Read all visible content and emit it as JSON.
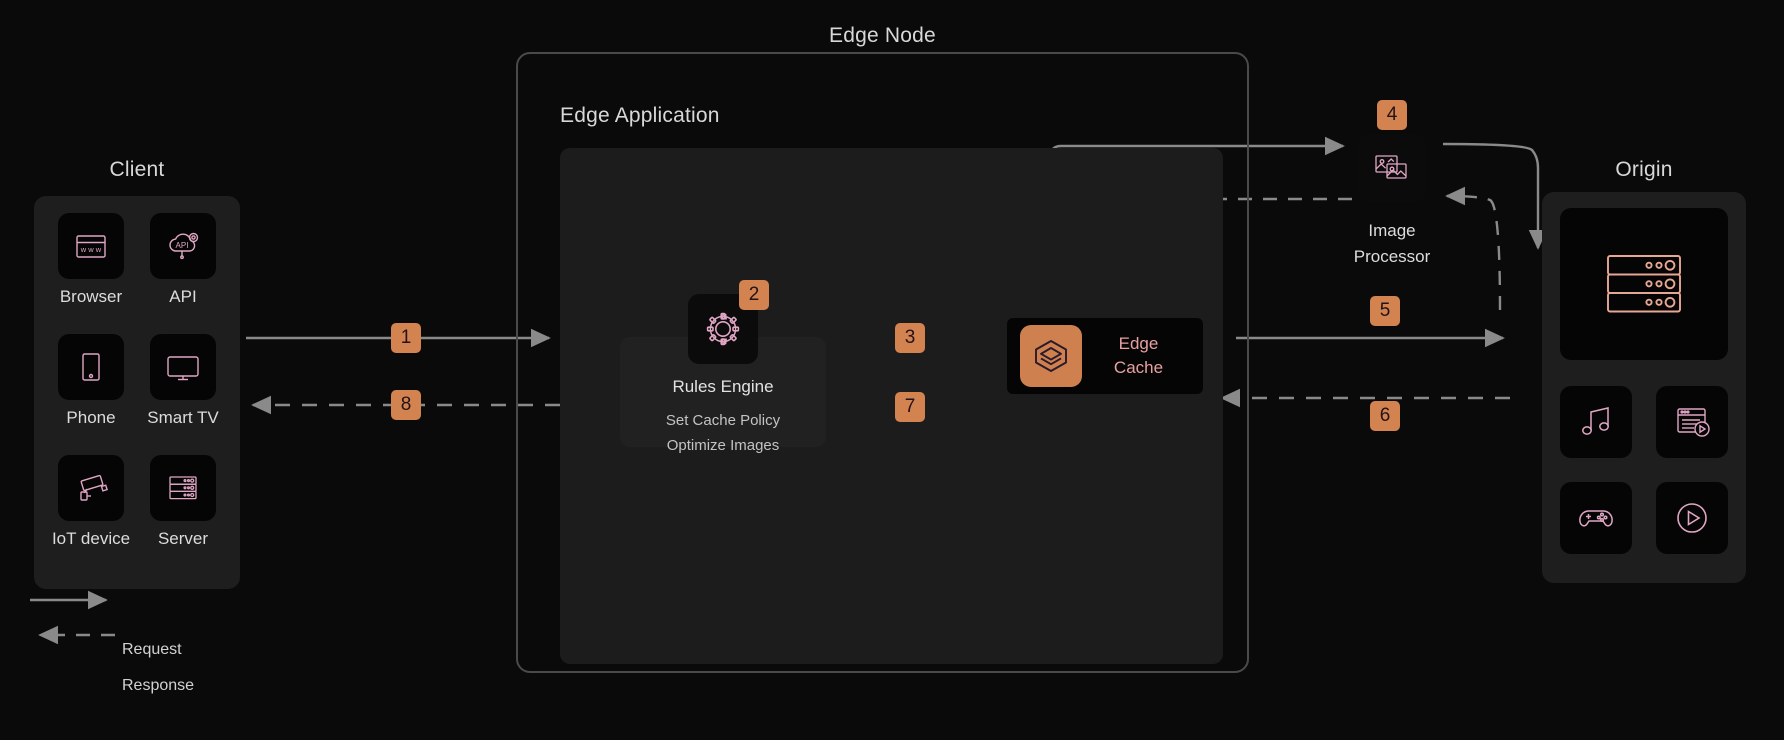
{
  "groups": {
    "client_title": "Client",
    "edge_node_title": "Edge Node",
    "edge_app_title": "Edge Application",
    "origin_title": "Origin"
  },
  "client": {
    "devices": [
      {
        "label": "Browser",
        "icon": "browser-www-icon"
      },
      {
        "label": "API",
        "icon": "api-cloud-icon"
      },
      {
        "label": "Phone",
        "icon": "phone-icon"
      },
      {
        "label": "Smart TV",
        "icon": "smart-tv-icon"
      },
      {
        "label": "IoT device",
        "icon": "security-camera-icon"
      },
      {
        "label": "Server",
        "icon": "server-rack-icon"
      }
    ]
  },
  "rules_engine": {
    "title": "Rules Engine",
    "icon": "gear-icon",
    "actions": [
      "Set Cache Policy",
      "Optimize Images"
    ]
  },
  "edge_cache": {
    "title_line1": "Edge",
    "title_line2": "Cache",
    "icon": "layers-stack-icon"
  },
  "image_processor": {
    "label_line1": "Image",
    "label_line2": "Processor",
    "icon": "image-processing-icon"
  },
  "origin": {
    "main": {
      "icon": "server-rack-icon"
    },
    "assets": [
      {
        "icon": "music-note-icon"
      },
      {
        "icon": "video-page-icon"
      },
      {
        "icon": "game-controller-icon"
      },
      {
        "icon": "play-circle-icon"
      }
    ]
  },
  "steps": [
    {
      "id": "1",
      "number": "1"
    },
    {
      "id": "2",
      "number": "2"
    },
    {
      "id": "3",
      "number": "3"
    },
    {
      "id": "4",
      "number": "4"
    },
    {
      "id": "5",
      "number": "5"
    },
    {
      "id": "6",
      "number": "6"
    },
    {
      "id": "7",
      "number": "7"
    },
    {
      "id": "8",
      "number": "8"
    }
  ],
  "legend": {
    "request": "Request",
    "response": "Response"
  },
  "colors": {
    "background": "#0a0a0a",
    "panel": "#1e1e1e",
    "tile": "#050505",
    "accent_orange": "#d3834f",
    "wire": "#8a8a8a",
    "icon_pink": "#e0a6c4",
    "origin_icon": "#e7a893",
    "cache_text": "#e8a0a0",
    "text": "#dcdcdc"
  }
}
